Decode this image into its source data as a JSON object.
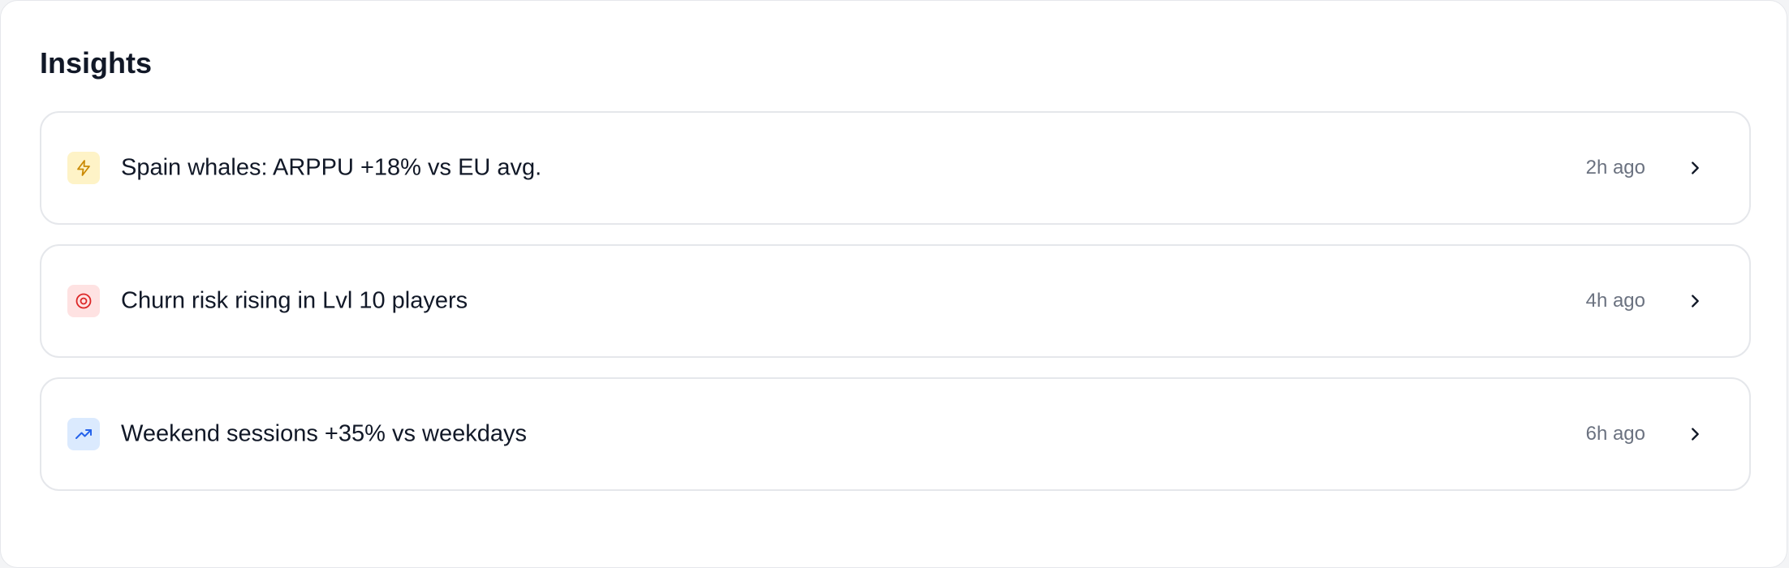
{
  "header": {
    "title": "Insights"
  },
  "insights": [
    {
      "text": "Spain whales: ARPPU +18% vs EU avg.",
      "time": "2h ago",
      "icon": "lightning-icon",
      "icon_bg": "#fef3c7",
      "icon_color": "#ca8a04"
    },
    {
      "text": "Churn risk rising in Lvl 10 players",
      "time": "4h ago",
      "icon": "target-icon",
      "icon_bg": "#fee2e2",
      "icon_color": "#dc2626"
    },
    {
      "text": "Weekend sessions +35% vs weekdays",
      "time": "6h ago",
      "icon": "trending-up-icon",
      "icon_bg": "#dbeafe",
      "icon_color": "#2563eb"
    }
  ]
}
